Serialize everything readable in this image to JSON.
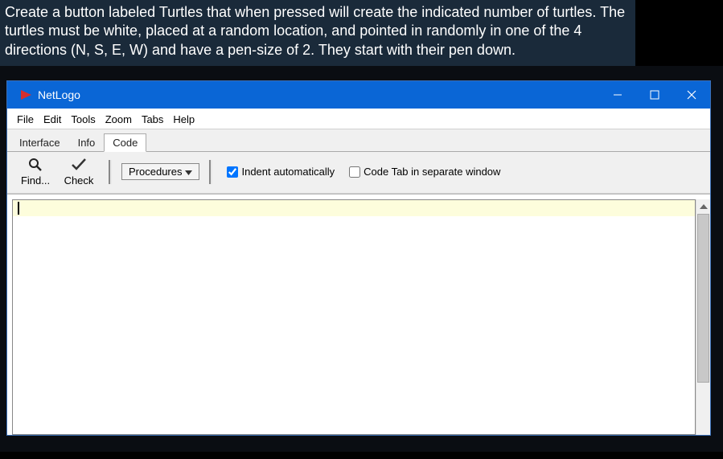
{
  "instructions": "Create a button labeled Turtles that when pressed will create the indicated number of turtles. The turtles must be white, placed at a random location, and pointed in randomly in one of the 4 directions (N, S, E, W) and have a pen-size of 2. They start with their pen down.",
  "window": {
    "title": "NetLogo"
  },
  "menu": {
    "file": "File",
    "edit": "Edit",
    "tools": "Tools",
    "zoom": "Zoom",
    "tabs": "Tabs",
    "help": "Help"
  },
  "tabs": {
    "interface": "Interface",
    "info": "Info",
    "code": "Code"
  },
  "toolbar": {
    "find": "Find...",
    "check": "Check",
    "procedures": "Procedures",
    "indent_label": "Indent automatically",
    "indent_checked": true,
    "separate_label": "Code Tab in separate window",
    "separate_checked": false
  },
  "editor": {
    "content": ""
  }
}
